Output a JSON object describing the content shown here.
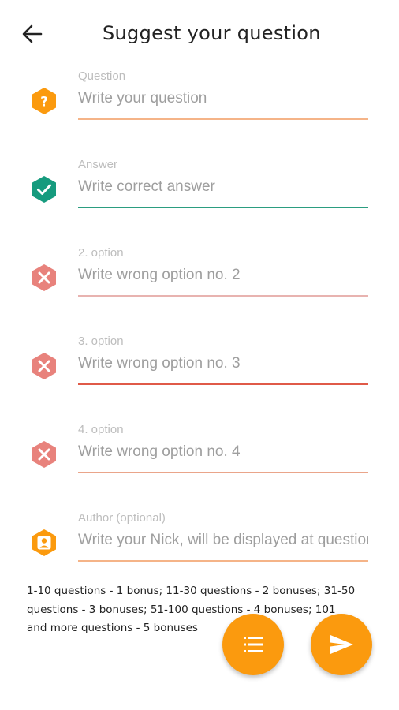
{
  "header": {
    "title": "Suggest your question",
    "back_icon": "arrow-left-icon"
  },
  "colors": {
    "orange": "#fb9a0e",
    "green": "#169b7e",
    "red": "#e8827c",
    "line_orange": "#f5b488",
    "line_green": "#2b9d80",
    "line_pink": "#e8b3b0",
    "line_red": "#e05a48",
    "line_salmon": "#eaa58a"
  },
  "fields": [
    {
      "label": "Question",
      "placeholder": "Write your question",
      "icon": "question-hex-icon"
    },
    {
      "label": "Answer",
      "placeholder": "Write correct answer",
      "icon": "check-hex-icon"
    },
    {
      "label": "2. option",
      "placeholder": "Write wrong option no. 2",
      "icon": "close-hex-icon"
    },
    {
      "label": "3. option",
      "placeholder": "Write wrong option no. 3",
      "icon": "close-hex-icon"
    },
    {
      "label": "4. option",
      "placeholder": "Write wrong option no. 4",
      "icon": "close-hex-icon"
    },
    {
      "label": "Author (optional)",
      "placeholder": "Write your Nick, will be displayed at questions",
      "icon": "person-hex-icon"
    }
  ],
  "info": {
    "text": "1-10 questions - 1 bonus; 11-30 questions - 2 bonuses; 31-50 questions - 3 bonuses; 51-100 questions - 4 bonuses; 101 and more questions - 5 bonuses"
  },
  "fabs": {
    "list_icon": "list-icon",
    "send_icon": "send-icon"
  }
}
